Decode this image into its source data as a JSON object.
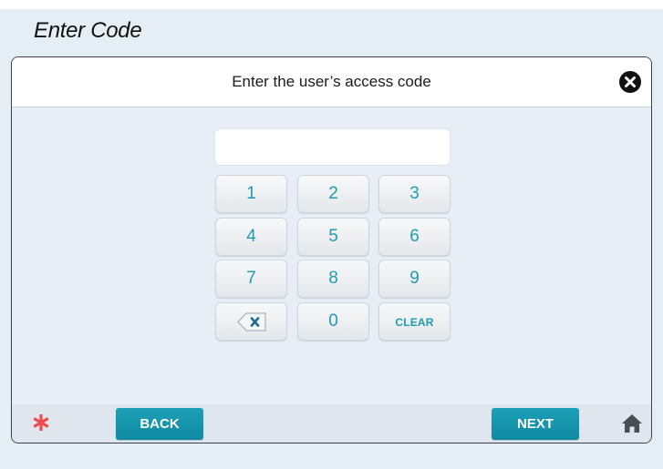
{
  "page": {
    "title": "Enter Code"
  },
  "dialog": {
    "heading": "Enter the user’s access code",
    "close_icon": "close-circle-icon"
  },
  "code_field": {
    "value": "",
    "placeholder": ""
  },
  "keypad": {
    "keys": [
      "1",
      "2",
      "3",
      "4",
      "5",
      "6",
      "7",
      "8",
      "9"
    ],
    "backspace_icon": "backspace-icon",
    "zero": "0",
    "clear": "CLEAR"
  },
  "footer": {
    "left_icon": "asterisk-icon",
    "back_label": "BACK",
    "next_label": "NEXT",
    "right_icon": "home-icon"
  },
  "colors": {
    "accent": "#1e9bb3",
    "button_fill": "#1299b0",
    "asterisk": "#f04a4a",
    "background": "#e6eef5"
  }
}
